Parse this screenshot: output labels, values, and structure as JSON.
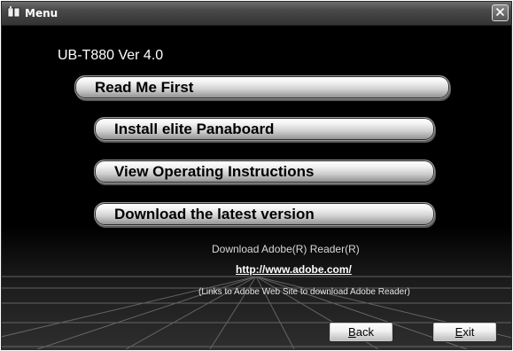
{
  "window": {
    "title": "Menu",
    "icon": "book-icon",
    "close_icon": "close-icon"
  },
  "header": {
    "version": "UB-T880 Ver 4.0"
  },
  "menu": {
    "items": [
      {
        "label": "Read Me First"
      },
      {
        "label": "Install elite Panaboard"
      },
      {
        "label": "View Operating Instructions"
      },
      {
        "label": "Download the latest version"
      }
    ]
  },
  "adobe": {
    "caption": "Download Adobe(R) Reader(R)",
    "link": "http://www.adobe.com/",
    "note": "(Links to Adobe Web Site to download Adobe Reader)"
  },
  "footer": {
    "back": {
      "accel": "B",
      "rest": "ack"
    },
    "exit": {
      "accel": "E",
      "rest": "xit"
    }
  },
  "colors": {
    "background": "#000000",
    "button_face": "#e8e8e8",
    "text": "#ffffff"
  }
}
